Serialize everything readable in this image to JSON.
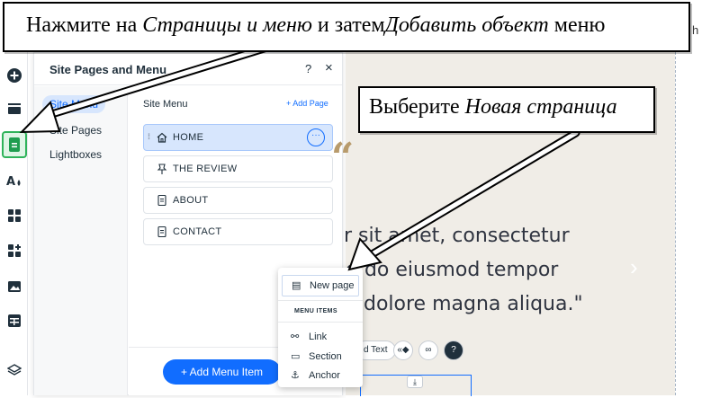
{
  "callouts": {
    "top": {
      "part1": "Нажмите на ",
      "em1": "Страницы и меню",
      "part2": " и затем",
      "em2": "Добавить объект",
      "part3": " меню"
    },
    "right": {
      "part1": "Выберите ",
      "em1": "Новая страница"
    },
    "edge_letter": "h"
  },
  "toolbar": {
    "icons": [
      "add-icon",
      "sections-icon",
      "pages-icon",
      "design-icon",
      "apps-icon",
      "add-apps-icon",
      "media-icon",
      "cms-icon",
      "layers-icon"
    ],
    "active": "pages-icon"
  },
  "panel": {
    "title": "Site Pages and Menu",
    "help_label": "?",
    "close_label": "×",
    "nav": [
      {
        "label": "Site Menu",
        "selected": true
      },
      {
        "label": "Site Pages",
        "selected": false
      },
      {
        "label": "Lightboxes",
        "selected": false
      }
    ],
    "main_title": "Site Menu",
    "add_page_label": "+ Add Page",
    "pages": [
      {
        "label": "HOME",
        "icon": "home-icon",
        "selected": true
      },
      {
        "label": "THE REVIEW",
        "icon": "pin-icon",
        "selected": false
      },
      {
        "label": "ABOUT",
        "icon": "page-icon",
        "selected": false
      },
      {
        "label": "CONTACT",
        "icon": "page-icon",
        "selected": false
      }
    ],
    "more_label": "···",
    "add_menu_item_label": "+ Add Menu Item"
  },
  "dropdown": {
    "new_page_label": "New page",
    "section_title": "MENU ITEMS",
    "items": [
      {
        "label": "Link",
        "icon": "link-icon"
      },
      {
        "label": "Section",
        "icon": "section-icon"
      },
      {
        "label": "Anchor",
        "icon": "anchor-icon"
      }
    ]
  },
  "canvas": {
    "quote_mark": "“",
    "lines": [
      "r sit amet, consectetur",
      "d do eiusmod tempor",
      "dolore magna aliqua.\""
    ],
    "text_chip": "d Text",
    "slide_arrow": "›"
  },
  "colors": {
    "accent": "#116dff",
    "active_tool": "#2fb35a",
    "canvas_bg": "#f0ede7",
    "quote": "#b89b6c"
  }
}
